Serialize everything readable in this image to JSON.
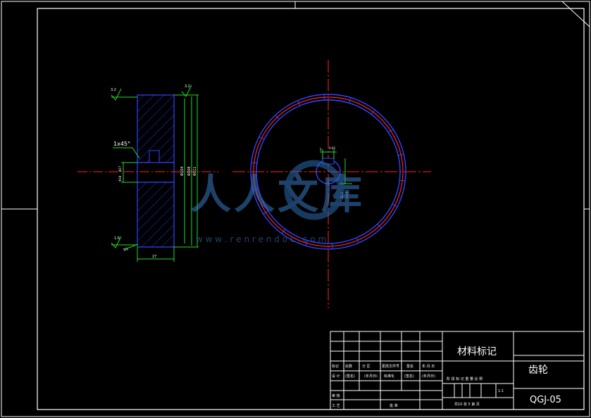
{
  "title_block": {
    "material_label": "材料标记",
    "part_name": "齿轮",
    "drawing_number": "QGJ-05",
    "scale": "1:1",
    "sheet_info": "共10 张 5 第 页",
    "headers_row1": [
      "标记",
      "处数",
      "分 区",
      "更改文件号",
      "签名",
      "年.月.日"
    ],
    "headers_row2": [
      "设 计",
      "(签名)",
      "(年月日)",
      "标准化",
      "(签名)",
      "(年月日)"
    ],
    "headers_row3": [
      "审 核"
    ],
    "headers_row4": [
      "工 艺",
      "批 准"
    ],
    "stage_header": "阶 段 标 记 重 量 比 例"
  },
  "annotations": {
    "chamfer": "1x45°",
    "roughness_top_left": "3.2",
    "roughness_top_right": "3.2",
    "roughness_bottom": "1.6",
    "dim_width": "27",
    "dim_bottom_left": "R1",
    "dim_d1": "Φ104",
    "dim_d2": "Φ108",
    "dim_d3": "Φ111",
    "dim_bore_a": "Φ27",
    "dim_bore_b": "Φ18",
    "dim_key_w": "5",
    "dim_key_h": "21.3",
    "dim_key_tol": "0.03",
    "dim_key_tol2": "+0.1"
  },
  "watermark": {
    "text": "人人文库",
    "url": "w w w . r e n r e n d o c . c o m"
  }
}
